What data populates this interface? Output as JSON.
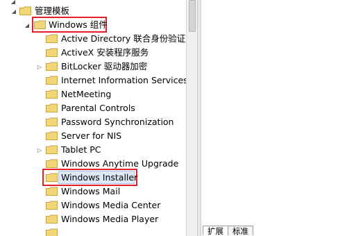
{
  "tree": {
    "root": {
      "label": "管理模板",
      "expanded": true
    },
    "windows_components": {
      "label": "Windows 组件",
      "expanded": true
    },
    "children": [
      {
        "label": "Active Directory 联合身份验证服",
        "has_children": false
      },
      {
        "label": "ActiveX 安装程序服务",
        "has_children": false
      },
      {
        "label": "BitLocker 驱动器加密",
        "has_children": true
      },
      {
        "label": "Internet Information Services",
        "has_children": false
      },
      {
        "label": "NetMeeting",
        "has_children": false
      },
      {
        "label": "Parental Controls",
        "has_children": false
      },
      {
        "label": "Password Synchronization",
        "has_children": false
      },
      {
        "label": "Server for NIS",
        "has_children": false
      },
      {
        "label": "Tablet PC",
        "has_children": true
      },
      {
        "label": "Windows Anytime Upgrade",
        "has_children": false
      },
      {
        "label": "Windows Installer",
        "has_children": false,
        "selected": true
      },
      {
        "label": "Windows Mail",
        "has_children": false
      },
      {
        "label": "Windows Media Center",
        "has_children": false
      },
      {
        "label": "Windows Media Player",
        "has_children": false
      }
    ]
  },
  "tabs": [
    {
      "label": "扩展",
      "active": true
    },
    {
      "label": "标准",
      "active": false
    }
  ],
  "colors": {
    "highlight_box": "#e0202a",
    "folder_fill": "#f3d67a",
    "folder_stroke": "#c9a43c"
  }
}
